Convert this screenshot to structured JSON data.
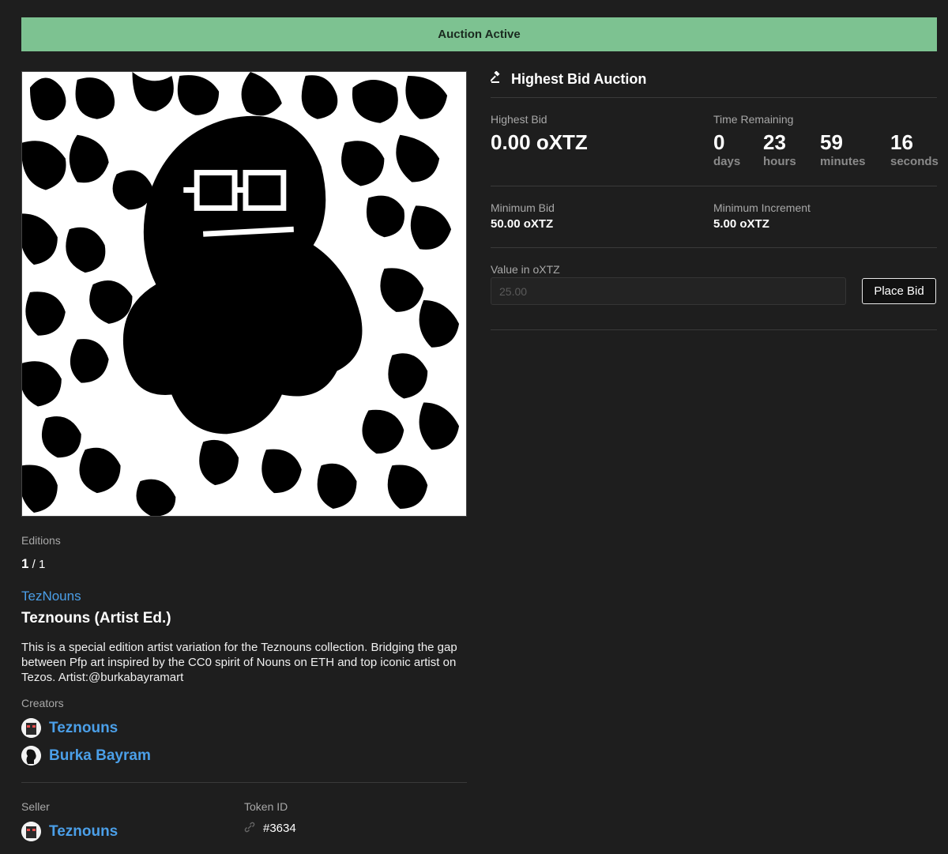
{
  "banner": {
    "status": "Auction Active"
  },
  "artwork": {
    "alt": "Teznouns (Artist Ed.) artwork"
  },
  "editions": {
    "label": "Editions",
    "current": "1",
    "total": "/ 1"
  },
  "token": {
    "collection": "TezNouns",
    "title": "Teznouns (Artist Ed.)",
    "description": "This is a special edition artist variation for the Teznouns collection. Bridging the gap between Pfp art inspired by the CC0 spirit of Nouns on ETH and top iconic artist on Tezos. Artist:@burkabayramart"
  },
  "creators": {
    "label": "Creators",
    "items": [
      {
        "name": "Teznouns",
        "avatar_icon": "teznouns-avatar-icon"
      },
      {
        "name": "Burka Bayram",
        "avatar_icon": "burka-avatar-icon"
      }
    ]
  },
  "seller": {
    "label": "Seller",
    "name": "Teznouns"
  },
  "token_id": {
    "label": "Token ID",
    "value": "#3634",
    "icon": "link-icon"
  },
  "auction": {
    "header": "Highest Bid Auction",
    "header_icon": "gavel-icon",
    "highest_bid_label": "Highest Bid",
    "highest_bid_value": "0.00 oXTZ",
    "time_remaining_label": "Time Remaining",
    "countdown": [
      {
        "value": "0",
        "unit": "days"
      },
      {
        "value": "23",
        "unit": "hours"
      },
      {
        "value": "59",
        "unit": "minutes"
      },
      {
        "value": "16",
        "unit": "seconds"
      }
    ],
    "minimum_bid_label": "Minimum Bid",
    "minimum_bid_value": "50.00 oXTZ",
    "minimum_increment_label": "Minimum Increment",
    "minimum_increment_value": "5.00 oXTZ",
    "value_label": "Value in oXTZ",
    "value_placeholder": "25.00",
    "place_bid_label": "Place Bid"
  },
  "colors": {
    "banner_bg": "#7dc291",
    "link": "#4b9fe8",
    "background": "#1e1e1e"
  }
}
